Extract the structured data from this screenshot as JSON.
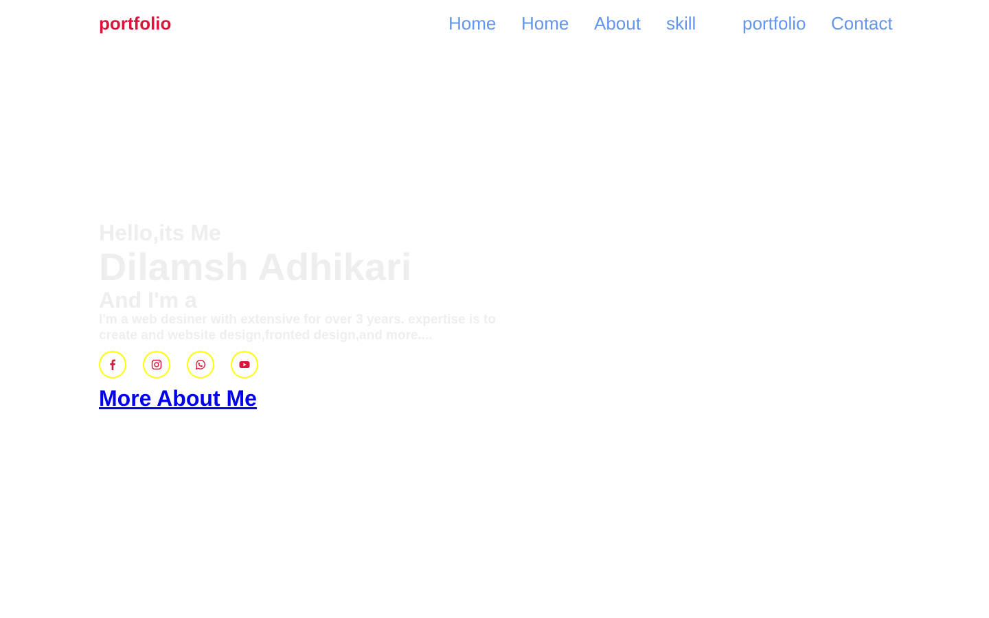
{
  "header": {
    "logo": "portfolio",
    "nav": [
      {
        "label": "Home"
      },
      {
        "label": "Home"
      },
      {
        "label": "About"
      },
      {
        "label": "skill"
      },
      {
        "label": "portfolio"
      },
      {
        "label": "Contact"
      }
    ]
  },
  "home": {
    "greeting": "Hello,its Me",
    "name": "Dilamsh Adhikari",
    "role": "And I'm a",
    "bio": "I'm a web desiner with extensive for over 3 years. expertise is to create and website design,fronted design,and more....",
    "socials": [
      {
        "icon": "facebook-icon"
      },
      {
        "icon": "instagram-icon"
      },
      {
        "icon": "whatsapp-icon"
      },
      {
        "icon": "youtube-icon"
      }
    ],
    "cta": "More About Me"
  },
  "colors": {
    "logo": "#dc143c",
    "nav": "#6495ed",
    "faded_text": "#eeeeee",
    "social_border": "#ffff00",
    "social_icon": "#dc143c",
    "link": "#0000ee"
  }
}
